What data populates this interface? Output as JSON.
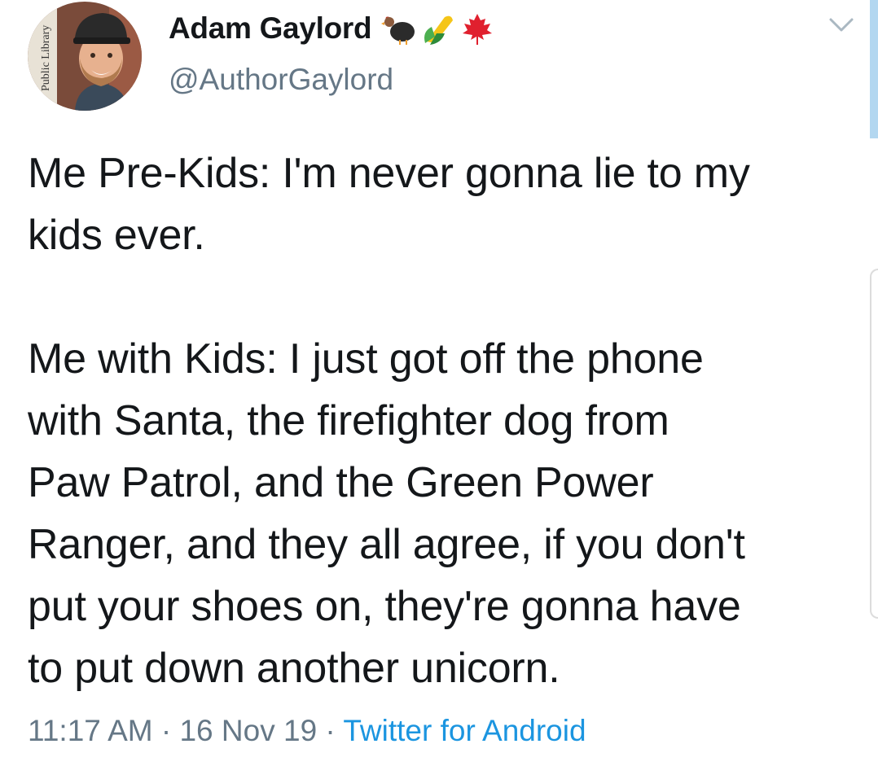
{
  "tweet": {
    "author": {
      "display_name": "Adam Gaylord",
      "handle": "@AuthorGaylord",
      "name_emojis": [
        "turkey-emoji",
        "corn-emoji",
        "maple-leaf-emoji"
      ]
    },
    "text": {
      "line_1": "Me Pre-Kids: I'm never gonna lie to my",
      "line_2": "kids ever.",
      "line_3": "Me with Kids: I just got off the phone",
      "line_4": "with Santa, the firefighter dog from",
      "line_5": "Paw Patrol, and the Green Power",
      "line_6": "Ranger, and they all agree, if you don't",
      "line_7": "put your shoes on, they're gonna have",
      "line_8": "to put down another unicorn."
    },
    "meta": {
      "time": "11:17 AM",
      "separator": " · ",
      "date": "16 Nov 19",
      "source": "Twitter for Android"
    },
    "avatar_sign_text": "Public Library"
  },
  "colors": {
    "text": "#14171a",
    "secondary": "#657786",
    "link": "#1b95e0"
  }
}
